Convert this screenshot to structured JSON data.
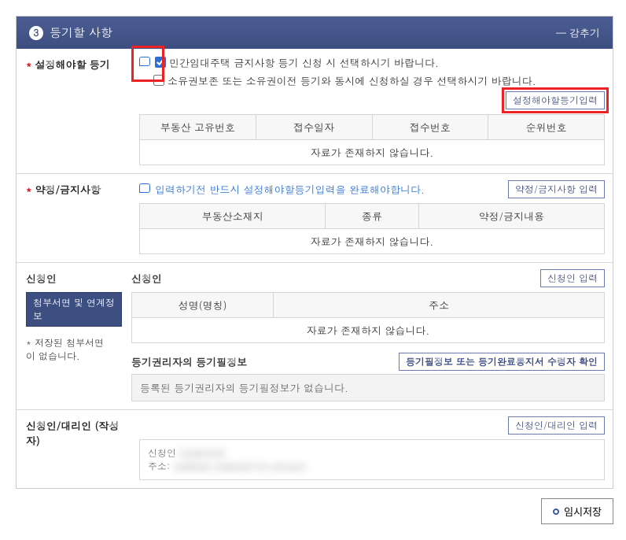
{
  "panel": {
    "step_number": "3",
    "title": "등기할 사항",
    "collapse_label": "감추기"
  },
  "reg_config": {
    "label": "설정해야할 등기",
    "check1_label": "민간임대주택 금지사항 등기 신청 시 선택하시기 바랍니다.",
    "check2_label": "소유권보존 또는 소유권이전 등기와 동시에 신청하실 경우 선택하시기 바랍니다.",
    "button_label": "설정해야할등기입력",
    "table_headers": [
      "부동산 고유번호",
      "접수일자",
      "접수번호",
      "순위번호"
    ],
    "empty_msg": "자료가 존재하지 않습니다."
  },
  "prohibition": {
    "label": "약정/금지사항",
    "info_text": "입력하기전 반드시 설정해야할등기입력을 완료해야합니다.",
    "button_label": "약정/금지사항 입력",
    "table_headers": [
      "부동산소재지",
      "종류",
      "약정/금지내용"
    ],
    "empty_msg": "자료가 존재하지 않습니다."
  },
  "applicant": {
    "label": "신청인",
    "attach_button": "첨부서면 및 연계정보",
    "saved_note_prefix": "* ",
    "saved_note": "저장된 첨부서면이 없습니다.",
    "section_title": "신청인",
    "input_button": "신청인 입력",
    "table_headers": [
      "성명(명칭)",
      "주소"
    ],
    "empty_msg": "자료가 존재하지 않습니다.",
    "regright_title": "등기권리자의 등기필정보",
    "regright_button": "등기필정보 또는 등기완료통지서 수령자 확인",
    "regright_note": "등록된 등기권리자의 등기필정보가 없습니다."
  },
  "agent": {
    "label": "신청인/대리인 (작성자)",
    "button_label": "신청인/대리인 입력",
    "name_label": "신청인",
    "name_value": "(redacted)",
    "addr_label": "주소:",
    "addr_value": "(address redacted for privacy)"
  },
  "footer": {
    "save_label": "임시저장"
  }
}
